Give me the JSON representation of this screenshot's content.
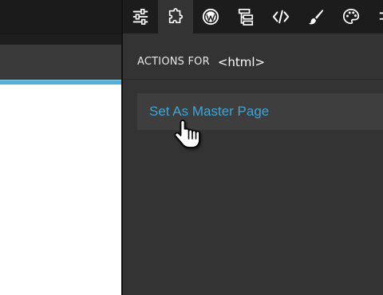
{
  "panel": {
    "icons": [
      {
        "name": "sliders-icon",
        "active": false
      },
      {
        "name": "puzzle-icon",
        "active": true
      },
      {
        "name": "wordpress-icon",
        "active": false
      },
      {
        "name": "tree-icon",
        "active": false
      },
      {
        "name": "code-icon",
        "active": false
      },
      {
        "name": "brush-icon",
        "active": false
      },
      {
        "name": "palette-icon",
        "active": false
      }
    ],
    "actions_label": "ACTIONS FOR",
    "actions_target": "<html>",
    "action_items": [
      {
        "label": "Set As Master Page"
      }
    ]
  },
  "colors": {
    "accent": "#4fb0d8",
    "link": "#3fa4d6",
    "panel_bg": "#333333",
    "icon_bar_bg": "#1c1c1c"
  },
  "cursor": {
    "name": "hand-pointer-icon"
  }
}
